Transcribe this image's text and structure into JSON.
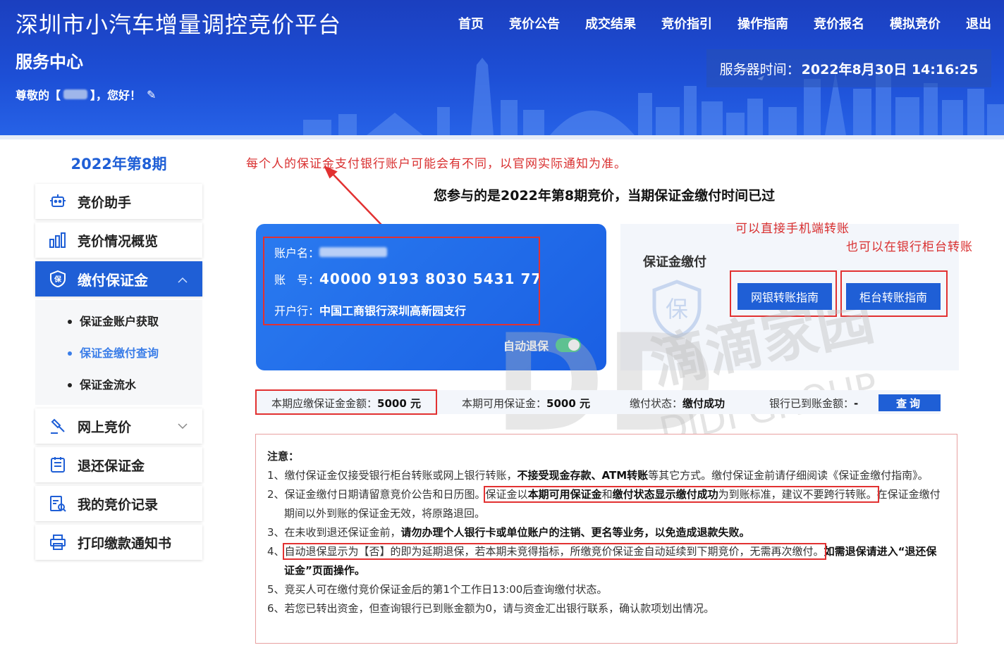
{
  "header": {
    "site_title": "深圳市小汽车增量调控竞价平台",
    "service_center": "服务中心",
    "greeting_prefix": "尊敬的【",
    "greeting_suffix": "】，您好！",
    "nav": [
      "首页",
      "竞价公告",
      "成交结果",
      "竞价指引",
      "操作指南",
      "竞价报名",
      "模拟竞价",
      "退出"
    ],
    "server_time_label": "服务器时间：",
    "server_time": "2022年8月30日 14:16:25"
  },
  "sidebar": {
    "period": "2022年第8期",
    "items": [
      {
        "label": "竞价助手",
        "icon": "robot-icon"
      },
      {
        "label": "竞价情况概览",
        "icon": "bar-chart-icon"
      },
      {
        "label": "缴付保证金",
        "icon": "shield-bao-icon"
      },
      {
        "label": "网上竞价",
        "icon": "gavel-icon"
      },
      {
        "label": "退还保证金",
        "icon": "refund-doc-icon"
      },
      {
        "label": "我的竞价记录",
        "icon": "record-search-icon"
      },
      {
        "label": "打印缴款通知书",
        "icon": "printer-icon"
      }
    ],
    "submenu": [
      "保证金账户获取",
      "保证金缴付查询",
      "保证金流水"
    ]
  },
  "main": {
    "annotation_top": "每个人的保证金支付银行账户可能会有不同，以官网实际通知为准。",
    "heading": "您参与的是2022年第8期竞价，当期保证金缴付时间已过",
    "card": {
      "account_name_label": "账户名：",
      "account_no_label": "账　号：",
      "account_no": "40000 9193 8030 5431 77",
      "bank_label": "开户行：",
      "bank": "中国工商银行深圳高新园支行",
      "auto_refund": "自动退保",
      "auto_refund_on": true
    },
    "pay_panel": {
      "title": "保证金缴付",
      "online_btn": "网银转账指南",
      "counter_btn": "柜台转账指南",
      "anno_mobile": "可以直接手机端转账",
      "anno_counter": "也可以在银行柜台转账"
    },
    "status": {
      "due_label": "本期应缴保证金金额：",
      "due_value": "5000 元",
      "avail_label": "本期可用保证金：",
      "avail_value": "5000 元",
      "state_label": "缴付状态：",
      "state_value": "缴付成功",
      "arrived_label": "银行已到账金额：",
      "arrived_value": "-",
      "query_btn": "查询"
    },
    "notice": {
      "title": "注意：",
      "l1a": "1、缴付保证金仅接受银行柜台转账或网上银行转账，",
      "l1b": "不接受现金存款、ATM转账",
      "l1c": "等其它方式。缴付保证金前请仔细阅读《保证金缴付指南》。",
      "l2a": "2、保证金缴付日期请留意竞价公告和日历图。",
      "l2b": "保证金以",
      "l2c": "本期可用保证金",
      "l2d": "和",
      "l2e": "缴付状态显示缴付成功",
      "l2f": "为到账标准，建议不要跨行转账。",
      "l2g": "在保证金缴付期间以外到账的保证金无效，将原路退回。",
      "l3a": "3、在未收到退还保证金前，",
      "l3b": "请勿办理个人银行卡或单位账户的注销、更名等业务，以免造成退款失败。",
      "l4a": "4、",
      "l4b": "自动退保显示为【否】的即为延期退保，若本期未竞得指标，所缴竞价保证金自动延续到下期竞价，无需再次缴付。",
      "l4c": "如需退保请进入“退还保证金”页面操作。",
      "l5": "5、竞买人可在缴付竞价保证金后的第1个工作日13:00后查询缴付状态。",
      "l6": "6、若您已转出资金，但查询银行已到账金额为0，请与资金汇出银行联系，确认款项划出情况。"
    },
    "watermark": {
      "big": "DD",
      "cn": "滴滴家园",
      "en": "DIDI GROUP"
    }
  },
  "colors": {
    "primary": "#1f5fd6",
    "annotation": "#d93030",
    "success_toggle": "#2cc47a"
  }
}
